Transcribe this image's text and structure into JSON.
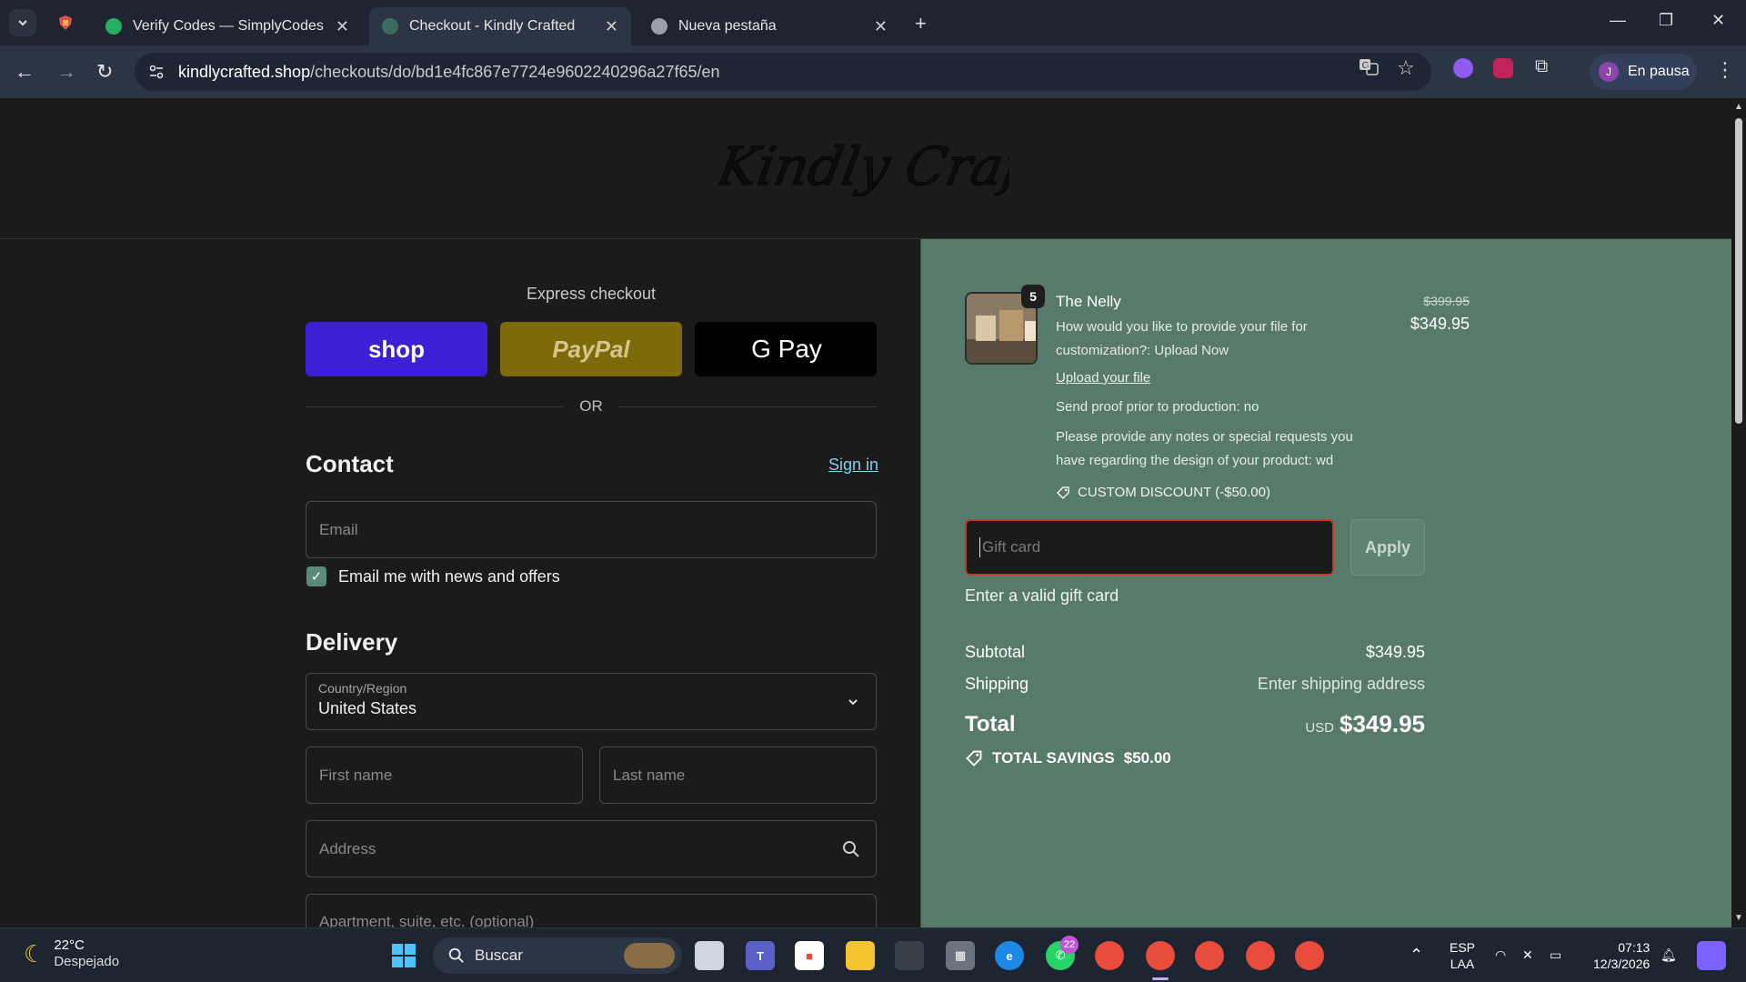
{
  "browser": {
    "tabs": [
      {
        "title": "Verify Codes — SimplyCodes",
        "close": "✕"
      },
      {
        "title": "Checkout - Kindly Crafted",
        "close": "✕"
      },
      {
        "title": "Nueva pestaña",
        "close": "✕"
      }
    ],
    "new_tab": "+",
    "url_host": "kindlycrafted.shop",
    "url_path": "/checkouts/do/bd1e4fc867e7724e9602240296a27f65/en",
    "profile_label": "En pausa",
    "profile_initial": "J"
  },
  "store": {
    "logo_text": "Kindly Crafted"
  },
  "checkout": {
    "express_title": "Express checkout",
    "shop_label": "shop",
    "paypal_label": "PayPal",
    "gpay_label": "G Pay",
    "or_label": "OR",
    "contact_title": "Contact",
    "sign_in": "Sign in",
    "email_placeholder": "Email",
    "newsletter_label": "Email me with news and offers",
    "newsletter_checked": true,
    "delivery_title": "Delivery",
    "country_label": "Country/Region",
    "country_value": "United States",
    "first_name_placeholder": "First name",
    "last_name_placeholder": "Last name",
    "address_placeholder": "Address",
    "apartment_placeholder": "Apartment, suite, etc. (optional)"
  },
  "summary": {
    "item": {
      "name": "The Nelly",
      "quantity": "5",
      "option_line_1": "How would you like to provide your file for customization?: Upload Now",
      "upload_link": "Upload your file",
      "option_line_2": "Send proof prior to production: no",
      "option_line_3": "Please provide any notes or special requests you have regarding the design of your product: wd",
      "discount": "CUSTOM DISCOUNT (-$50.00)",
      "old_price": "$399.95",
      "price": "$349.95"
    },
    "gift_placeholder": "Gift card",
    "apply_label": "Apply",
    "gift_error": "Enter a valid gift card",
    "subtotal_label": "Subtotal",
    "subtotal_value": "$349.95",
    "shipping_label": "Shipping",
    "shipping_value": "Enter shipping address",
    "total_label": "Total",
    "total_currency": "USD",
    "total_value": "$349.95",
    "savings_label": "TOTAL SAVINGS",
    "savings_value": "$50.00"
  },
  "taskbar": {
    "temperature": "22°C",
    "condition": "Despejado",
    "search_label": "Buscar",
    "whatsapp_badge": "22",
    "lang_top": "ESP",
    "lang_bottom": "LAA",
    "time": "07:13",
    "date": "12/3/2026"
  },
  "colors": {
    "summary_bg": "#587a6b",
    "page_bg": "#1b1b1b",
    "shop_pay": "#3e1fd6",
    "error_border": "#c0392b"
  }
}
